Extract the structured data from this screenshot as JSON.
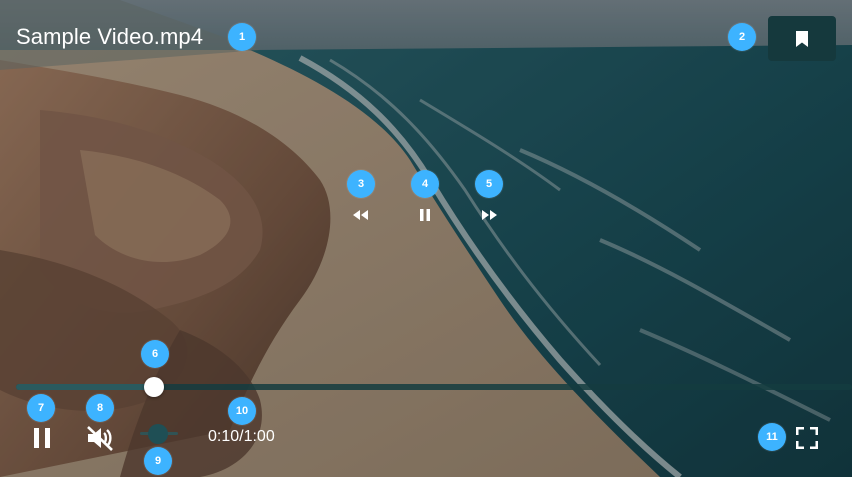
{
  "video": {
    "title": "Sample Video.mp4",
    "current_time": "0:10",
    "duration": "1:00",
    "time_display": "0:10/1:00",
    "progress_fraction": 0.165,
    "muted": true,
    "volume_fraction": 0.0,
    "state": "playing"
  },
  "badges": [
    "1",
    "2",
    "3",
    "4",
    "5",
    "6",
    "7",
    "8",
    "9",
    "10",
    "11"
  ],
  "icons": {
    "bookmark": "bookmark-icon",
    "rewind": "rewind-icon",
    "center_pause": "pause-icon",
    "fast_forward": "fast-forward-icon",
    "pause": "pause-icon",
    "mute": "volume-off-icon",
    "fullscreen": "fullscreen-icon"
  },
  "colors": {
    "badge": "#3db3ff",
    "bookmark_button_bg": "#15393d",
    "progress_track": "#143c40",
    "progress_thumb": "#ffffff",
    "text": "#ffffff"
  }
}
